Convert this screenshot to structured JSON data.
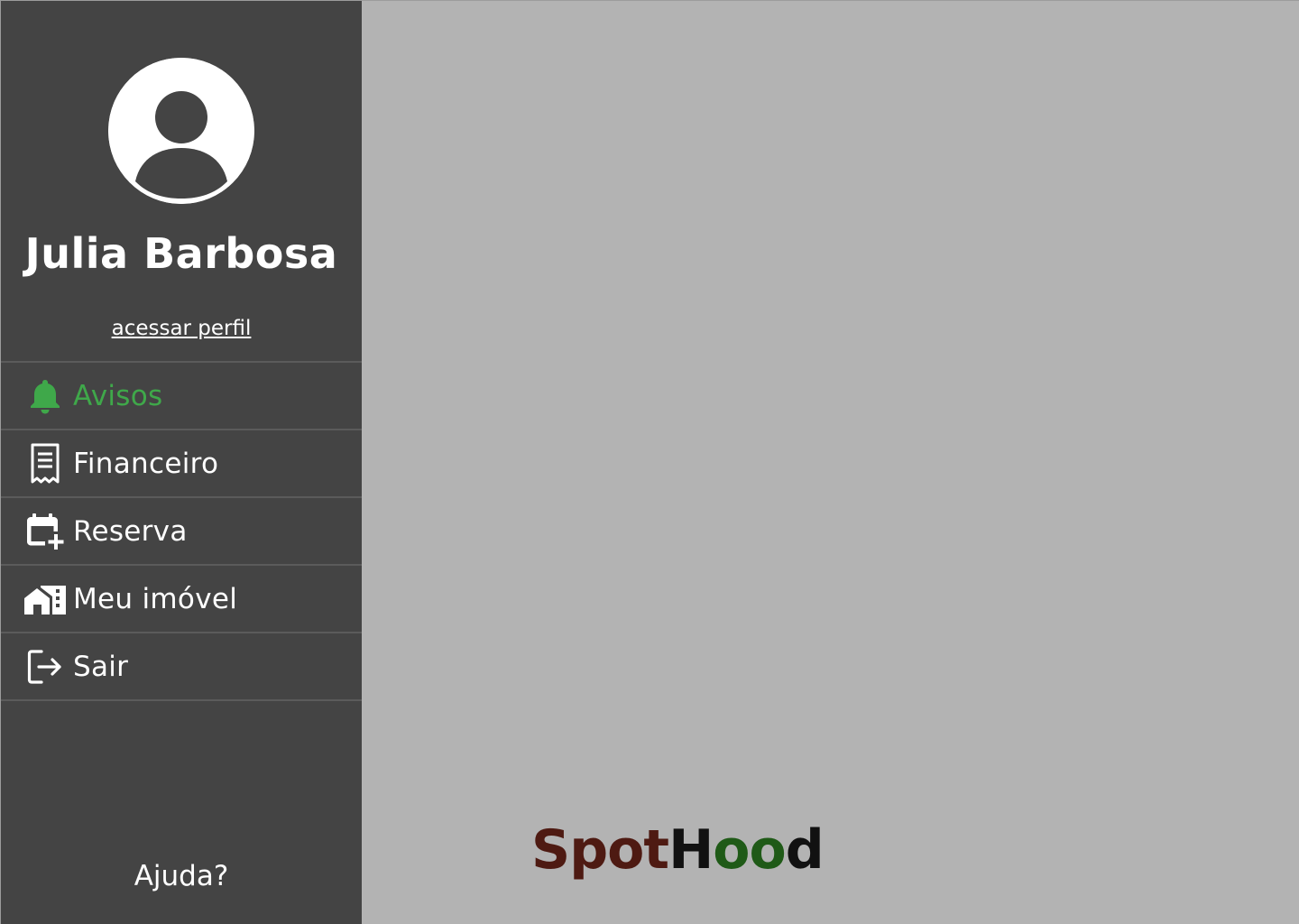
{
  "profile": {
    "name": "Julia Barbosa",
    "link_label": "acessar perfil",
    "avatar_icon": "user-avatar-icon"
  },
  "menu": {
    "items": [
      {
        "label": "Avisos",
        "icon": "bell-icon",
        "active": true
      },
      {
        "label": "Financeiro",
        "icon": "receipt-icon",
        "active": false
      },
      {
        "label": "Reserva",
        "icon": "calendar-add-icon",
        "active": false
      },
      {
        "label": "Meu imóvel",
        "icon": "home-building-icon",
        "active": false
      },
      {
        "label": "Sair",
        "icon": "logout-icon",
        "active": false
      }
    ]
  },
  "help_label": "Ajuda?",
  "brand": {
    "part1": "Spot",
    "part2": "H",
    "part3": "oo",
    "part4": "d",
    "colors": {
      "spot": "#4e1a12",
      "h": "#111111",
      "oo": "#1f5a17",
      "d": "#111111"
    }
  },
  "colors": {
    "sidebar_bg": "#444444",
    "content_bg": "#b3b3b3",
    "active_accent": "#3fa84a",
    "text": "#ffffff"
  }
}
